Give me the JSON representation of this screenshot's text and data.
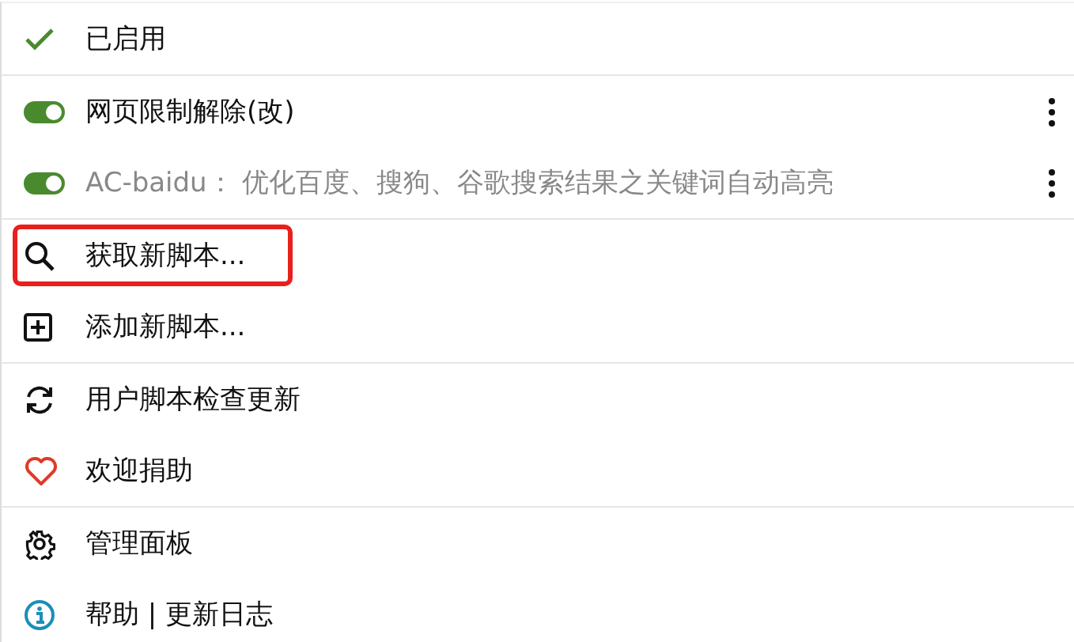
{
  "sections": [
    {
      "items": [
        {
          "kind": "check",
          "label": "已启用"
        }
      ]
    },
    {
      "items": [
        {
          "kind": "script",
          "label": "网页限制解除(改)",
          "on": true,
          "active": true
        },
        {
          "kind": "script",
          "label": "AC-baidu： 优化百度、搜狗、谷歌搜索结果之关键词自动高亮",
          "on": true,
          "active": false
        }
      ]
    },
    {
      "items": [
        {
          "kind": "search",
          "label": "获取新脚本...",
          "highlighted": true
        },
        {
          "kind": "add",
          "label": "添加新脚本...",
          "highlighted": false
        }
      ]
    },
    {
      "items": [
        {
          "kind": "update",
          "label": "用户脚本检查更新"
        },
        {
          "kind": "donate",
          "label": "欢迎捐助"
        }
      ]
    },
    {
      "items": [
        {
          "kind": "settings",
          "label": "管理面板"
        },
        {
          "kind": "info",
          "label": "帮助 | 更新日志"
        }
      ]
    }
  ]
}
